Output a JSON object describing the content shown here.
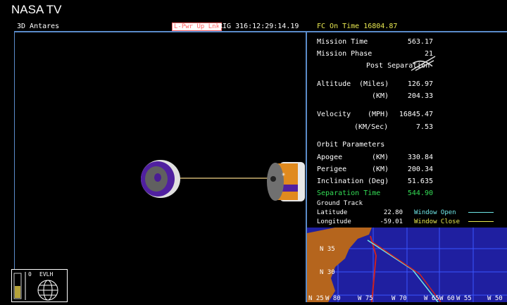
{
  "brand": "NASA TV",
  "viewport": {
    "title": "3D Antares",
    "status_badge": "L-Pwr Up Lnk",
    "rig_clock": "RIG 316:12:29:14.19"
  },
  "panel": {
    "fc_on_time": "FC On Time 16804.87",
    "mission_time": {
      "label": "Mission Time",
      "value": "563.17"
    },
    "mission_phase": {
      "label": "Mission Phase",
      "value": "21",
      "phase_name": "Post Separation"
    },
    "altitude": {
      "label": "Altitude",
      "unit_miles": "(Miles)",
      "miles": "126.97",
      "unit_km": "(KM)",
      "km": "204.33"
    },
    "velocity": {
      "label": "Velocity",
      "unit_mph": "(MPH)",
      "mph": "16845.47",
      "unit_kms": "(KM/Sec)",
      "kms": "7.53"
    },
    "orbit": {
      "header": "Orbit Parameters",
      "apogee": {
        "label": "Apogee",
        "unit": "(KM)",
        "value": "330.84"
      },
      "perigee": {
        "label": "Perigee",
        "unit": "(KM)",
        "value": "200.34"
      },
      "inclination": {
        "label": "Inclination",
        "unit": "(Deg)",
        "value": "51.635"
      }
    },
    "separation": {
      "label": "Separation Time",
      "value": "544.90"
    },
    "ground_track": {
      "header": "Ground Track",
      "latitude": {
        "label": "Latitude",
        "value": "22.80"
      },
      "longitude": {
        "label": "Longitude",
        "value": "-59.01"
      },
      "window_open": "Window Open",
      "window_close": "Window Close"
    }
  },
  "map": {
    "lat_labels": [
      "N 35",
      "N 30",
      "N 25"
    ],
    "lon_labels": [
      "W 80",
      "W 75",
      "W 70",
      "W 65",
      "W 60",
      "W 55",
      "W 50"
    ],
    "colors": {
      "ocean": "#1f1fa0",
      "land": "#b5651d",
      "grid": "#3a55ff",
      "track": "#cc2222",
      "window_open": "#6fe6e6",
      "window_close": "#e8e850"
    }
  },
  "mini_widget": {
    "label": "EVLH",
    "gauge_value": "0"
  },
  "colors": {
    "border": "#5a8bc9",
    "separation": "#33dd55",
    "fc_time": "#e8e850"
  }
}
